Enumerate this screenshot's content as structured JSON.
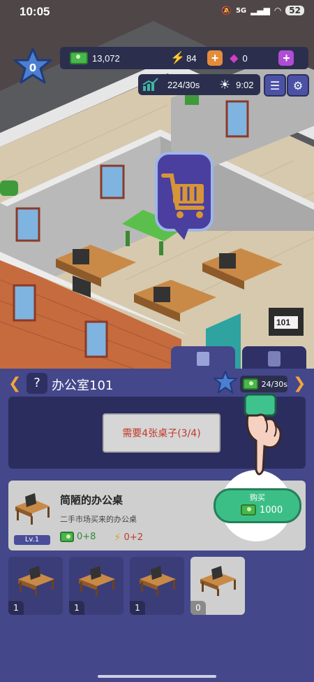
{
  "status_bar": {
    "time": "10:05",
    "network": "5G",
    "battery": "52"
  },
  "hud": {
    "level": "0",
    "cash": "13,072",
    "energy": "84",
    "gems": "0",
    "income_rate": "224/30s",
    "clock": "9:02"
  },
  "room": {
    "help": "?",
    "name": "办公室101",
    "rate": "24/30s",
    "door_number": "101",
    "requirement": "需要4张桌子(3/4)"
  },
  "item": {
    "name": "简陋的办公桌",
    "description": "二手市场买来的办公桌",
    "level": "Lv.1",
    "stat_cash": "0+8",
    "stat_energy": "0+2",
    "buy_label": "购买",
    "price": "1000"
  },
  "slots": [
    {
      "count": "1"
    },
    {
      "count": "1"
    },
    {
      "count": "1"
    },
    {
      "count": "0"
    }
  ],
  "colors": {
    "panel": "#44478a",
    "buy_button": "#3cbf86",
    "requirement_text": "#c0392b",
    "stat_cash": "#2e8b3a",
    "stat_energy": "#c0392b"
  },
  "icons": [
    "cash-icon",
    "lightning-icon",
    "gem-icon",
    "chart-icon",
    "sun-icon",
    "list-icon",
    "gear-icon",
    "building-icon",
    "clipboard-icon",
    "cart-icon",
    "pointing-hand-icon"
  ]
}
